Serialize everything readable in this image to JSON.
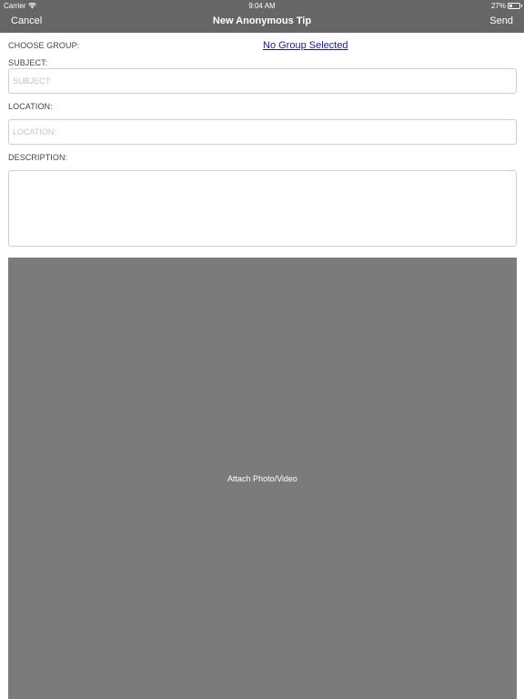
{
  "status_bar": {
    "carrier": "Carrier",
    "time": "9:04 AM",
    "battery_percent": "27%",
    "battery_level": 0.27,
    "wifi_icon": "wifi-icon",
    "battery_icon": "battery-icon"
  },
  "nav": {
    "cancel_label": "Cancel",
    "title": "New Anonymous Tip",
    "send_label": "Send"
  },
  "form": {
    "group_label": "CHOOSE GROUP:",
    "group_value": "No Group Selected",
    "subject_label": "SUBJECT:",
    "subject_placeholder": "SUBJECT:",
    "subject_value": "",
    "location_label": "LOCATION:",
    "location_placeholder": "LOCATION:",
    "location_value": "",
    "description_label": "DESCRIPTION:",
    "description_value": ""
  },
  "attach": {
    "label": "Attach Photo/Video"
  },
  "colors": {
    "topbar": "#666666",
    "attach_area": "#7b7b7b",
    "link": "#1a1aa6"
  }
}
